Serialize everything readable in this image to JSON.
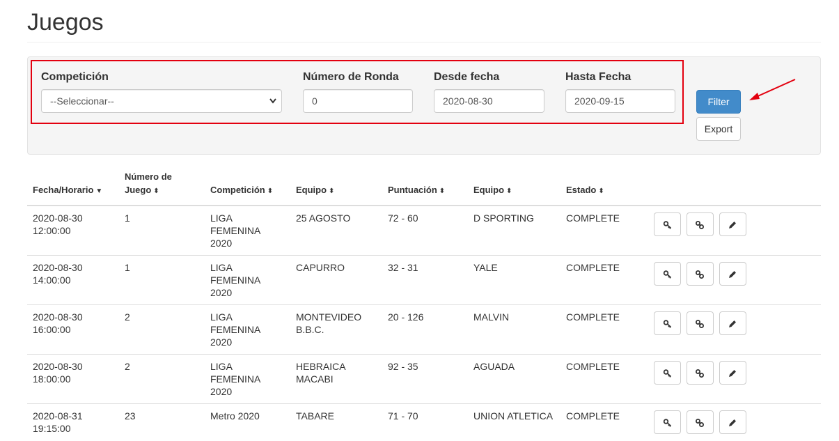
{
  "page": {
    "title": "Juegos"
  },
  "filters": {
    "competicion": {
      "label": "Competición",
      "value": "--Seleccionar--"
    },
    "ronda": {
      "label": "Número de Ronda",
      "value": "0"
    },
    "desde": {
      "label": "Desde fecha",
      "value": "2020-08-30"
    },
    "hasta": {
      "label": "Hasta Fecha",
      "value": "2020-09-15"
    },
    "filter_button": "Filter",
    "export_button": "Export"
  },
  "table": {
    "headers": {
      "fecha": "Fecha/Horario",
      "numero_line1": "Número de",
      "numero_line2": "Juego",
      "competicion": "Competición",
      "equipo1": "Equipo",
      "puntuacion": "Puntuación",
      "equipo2": "Equipo",
      "estado": "Estado"
    },
    "rows": [
      {
        "date": "2020-08-30",
        "time": "12:00:00",
        "numero": "1",
        "comp1": "LIGA FEMENINA",
        "comp2": "2020",
        "team1a": "25 AGOSTO",
        "team1b": "",
        "score": "72 - 60",
        "team2": "D SPORTING",
        "estado": "COMPLETE"
      },
      {
        "date": "2020-08-30",
        "time": "14:00:00",
        "numero": "1",
        "comp1": "LIGA FEMENINA",
        "comp2": "2020",
        "team1a": "CAPURRO",
        "team1b": "",
        "score": "32 - 31",
        "team2": "YALE",
        "estado": "COMPLETE"
      },
      {
        "date": "2020-08-30",
        "time": "16:00:00",
        "numero": "2",
        "comp1": "LIGA FEMENINA",
        "comp2": "2020",
        "team1a": "MONTEVIDEO",
        "team1b": "B.B.C.",
        "score": "20 - 126",
        "team2": "MALVIN",
        "estado": "COMPLETE"
      },
      {
        "date": "2020-08-30",
        "time": "18:00:00",
        "numero": "2",
        "comp1": "LIGA FEMENINA",
        "comp2": "2020",
        "team1a": "HEBRAICA",
        "team1b": "MACABI",
        "score": "92 - 35",
        "team2": "AGUADA",
        "estado": "COMPLETE"
      },
      {
        "date": "2020-08-31",
        "time": "19:15:00",
        "numero": "23",
        "comp1": "Metro 2020",
        "comp2": "",
        "team1a": "TABARE",
        "team1b": "",
        "score": "71 - 70",
        "team2": "UNION ATLETICA",
        "estado": "COMPLETE"
      }
    ]
  },
  "icons": {
    "sort_desc": "caret-down-icon",
    "sort_both": "sort-icon",
    "select_chevron": "chevron-down-icon",
    "row_actions": [
      "key-icon",
      "link-icon",
      "pencil-icon"
    ]
  },
  "colors": {
    "highlight": "#e3000f",
    "primary": "#428bca",
    "annotation_arrow": "#e3000f"
  }
}
